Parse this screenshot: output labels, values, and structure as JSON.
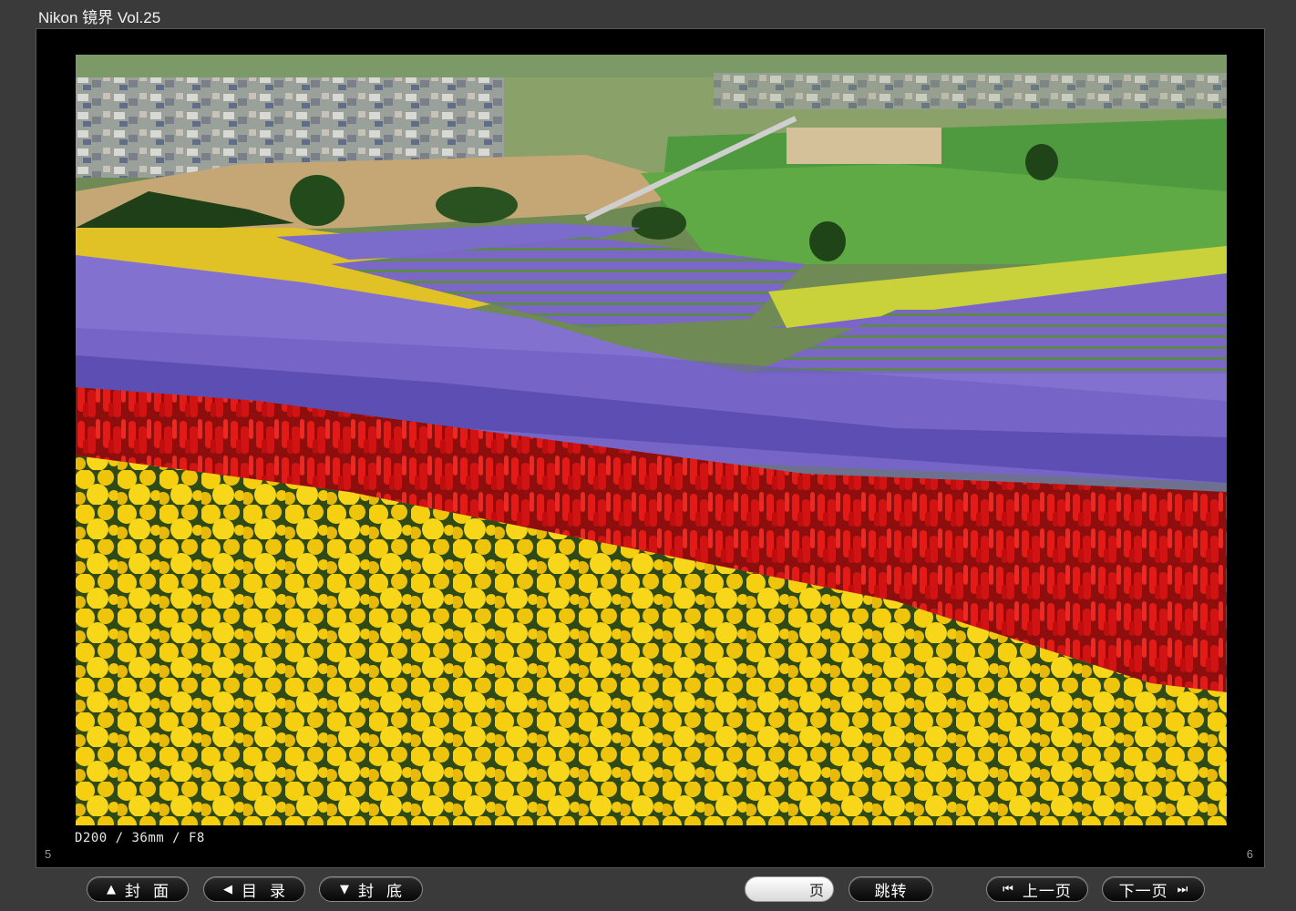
{
  "app": {
    "title": "Nikon 镜界 Vol.25"
  },
  "viewer": {
    "caption": "D200 / 36mm / F8",
    "page_left": "5",
    "page_right": "6"
  },
  "toolbar": {
    "cover": {
      "label": "封面",
      "icon": "triangle-up-icon"
    },
    "contents": {
      "label": "目录",
      "icon": "triangle-left-icon"
    },
    "back_cover": {
      "label": "封底",
      "icon": "triangle-down-icon"
    },
    "page_input": {
      "value": "",
      "unit": "页"
    },
    "jump": {
      "label": "跳转"
    },
    "prev": {
      "label": "上一页",
      "icon": "skip-back-icon"
    },
    "next": {
      "label": "下一页",
      "icon": "skip-forward-icon"
    }
  },
  "colors": {
    "background": "#3a3a3a",
    "viewer_frame": "#000000",
    "button_bg": "#111111",
    "input_bg": "#f0f0f0"
  }
}
